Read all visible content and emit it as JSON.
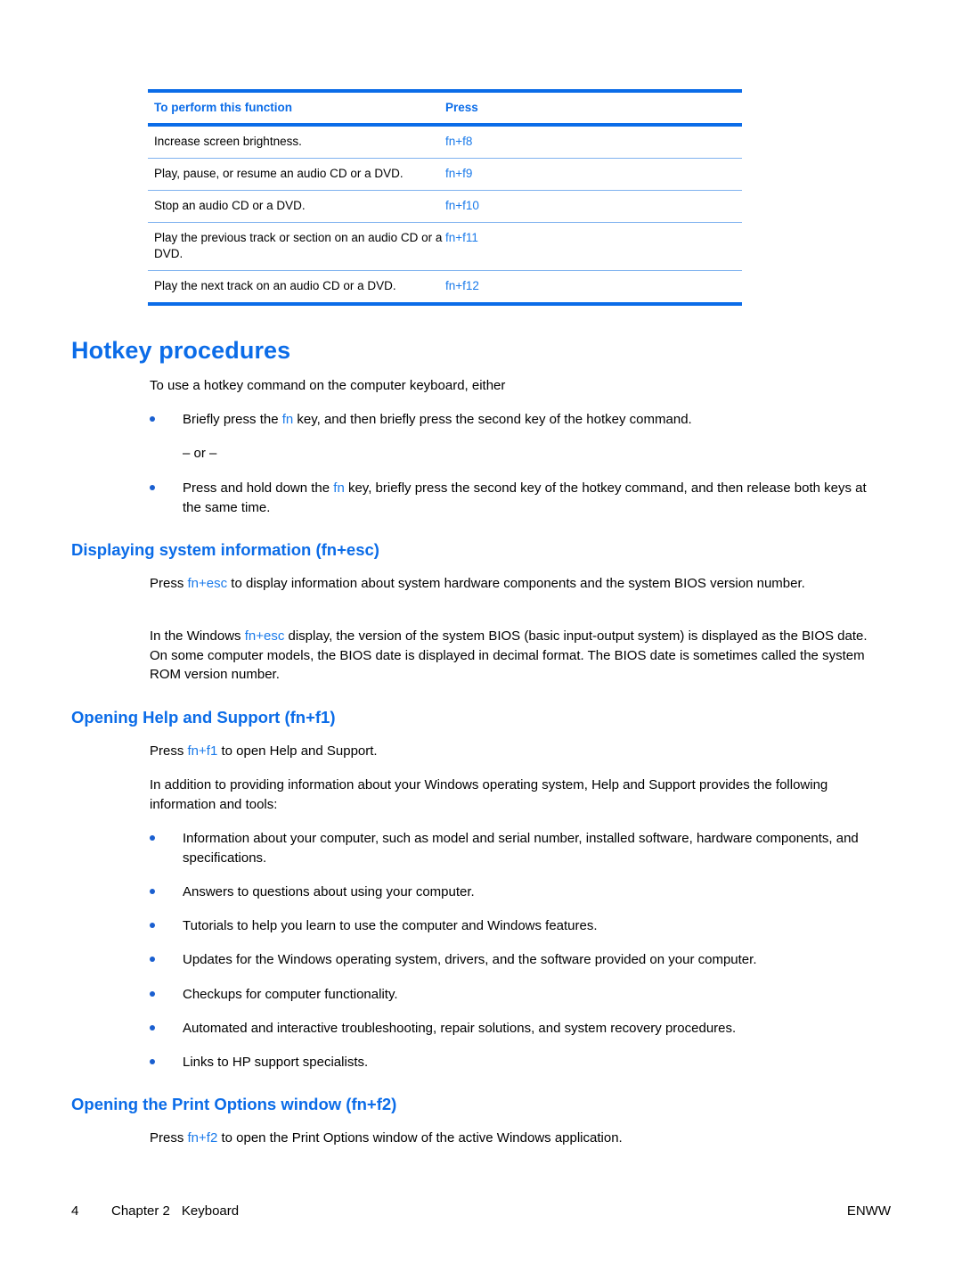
{
  "table": {
    "columns": [
      "To perform this function",
      "Press"
    ],
    "rows": [
      {
        "function": "Increase screen brightness.",
        "press": "fn+f8"
      },
      {
        "function": "Play, pause, or resume an audio CD or a DVD.",
        "press": "fn+f9"
      },
      {
        "function": "Stop an audio CD or a DVD.",
        "press": "fn+f10"
      },
      {
        "function": "Play the previous track or section on an audio CD or a DVD.",
        "press": "fn+f11"
      },
      {
        "function": "Play the next track on an audio CD or a DVD.",
        "press": "fn+f12"
      }
    ]
  },
  "sections": {
    "hotkey_procedures": {
      "heading": "Hotkey procedures",
      "intro": "To use a hotkey command on the computer keyboard, either",
      "bullet1_pre": "Briefly press the ",
      "bullet1_key": "fn",
      "bullet1_post": " key, and then briefly press the second key of the hotkey command.",
      "or_text": "– or –",
      "bullet2_pre": "Press and hold down the ",
      "bullet2_key": "fn",
      "bullet2_post": " key, briefly press the second key of the hotkey command, and then release both keys at the same time."
    },
    "system_information": {
      "heading": "Displaying system information (fn+esc)",
      "p1_pre": "Press ",
      "p1_key": "fn+esc",
      "p1_post": " to display information about system hardware components and the system BIOS version number.",
      "p2_pre": "In the Windows ",
      "p2_key": "fn+esc",
      "p2_post": " display, the version of the system BIOS (basic input-output system) is displayed as the BIOS date. On some computer models, the BIOS date is displayed in decimal format. The BIOS date is sometimes called the system ROM version number."
    },
    "help_and_support": {
      "heading": "Opening Help and Support (fn+f1)",
      "p1_pre": "Press ",
      "p1_key": "fn+f1",
      "p1_post": " to open Help and Support.",
      "p2": "In addition to providing information about your Windows operating system, Help and Support provides the following information and tools:",
      "bullets": [
        "Information about your computer, such as model and serial number, installed software, hardware components, and specifications.",
        "Answers to questions about using your computer.",
        "Tutorials to help you learn to use the computer and Windows features.",
        "Updates for the Windows operating system, drivers, and the software provided on your computer.",
        "Checkups for computer functionality.",
        "Automated and interactive troubleshooting, repair solutions, and system recovery procedures.",
        "Links to HP support specialists."
      ]
    },
    "print_options": {
      "heading": "Opening the Print Options window (fn+f2)",
      "p1_pre": "Press ",
      "p1_key": "fn+f2",
      "p1_post": " to open the Print Options window of the active Windows application."
    }
  },
  "footer": {
    "page_number": "4",
    "chapter": "Chapter 2",
    "chapter_title": "Keyboard",
    "locale": "ENWW"
  },
  "colors": {
    "accent_blue": "#0b6ce8",
    "link_blue": "#1a7aea",
    "rule_light": "#7fb2ef"
  }
}
